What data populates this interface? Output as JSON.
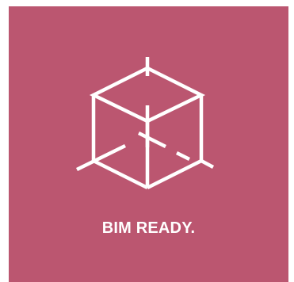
{
  "tile": {
    "label": "BIM READY.",
    "icon": "wireframe-cube-icon",
    "background_color": "#bb5670",
    "foreground_color": "#ffffff"
  }
}
